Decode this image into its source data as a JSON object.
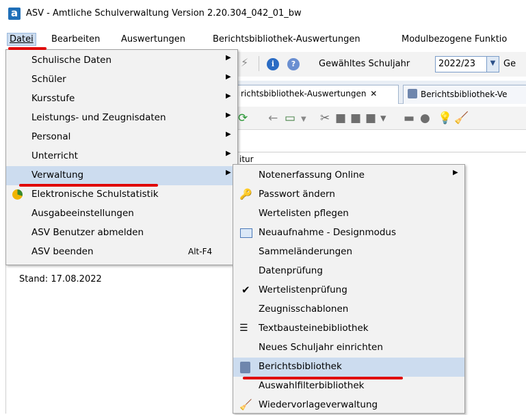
{
  "window": {
    "title": "ASV - Amtliche Schulverwaltung Version 2.20.304_042_01_bw",
    "logo_letter": "a"
  },
  "menubar": [
    {
      "label": "Datei"
    },
    {
      "label": "Bearbeiten"
    },
    {
      "label": "Auswertungen"
    },
    {
      "label": "Berichtsbibliothek-Auswertungen"
    },
    {
      "label": "Modulbezogene Funktio"
    }
  ],
  "toolbar": {
    "schuljahr_label": "Gewähltes Schuljahr",
    "schuljahr_value": "2022/23",
    "trailing_text": "Ge"
  },
  "tabs": [
    {
      "label": "richtsbibliothek-Auswertungen",
      "close": "✕"
    },
    {
      "label": "Berichtsbibliothek-Ve"
    }
  ],
  "partial_label": "itur",
  "stand": "Stand: 17.08.2022",
  "datei_menu": [
    {
      "label": "Schulische Daten",
      "submenu": true
    },
    {
      "label": "Schüler",
      "submenu": true
    },
    {
      "label": "Kursstufe",
      "submenu": true
    },
    {
      "label": "Leistungs- und Zeugnisdaten",
      "submenu": true
    },
    {
      "label": "Personal",
      "submenu": true
    },
    {
      "label": "Unterricht",
      "submenu": true
    },
    {
      "label": "Verwaltung",
      "submenu": true,
      "highlighted": true
    },
    {
      "label": "Elektronische Schulstatistik",
      "icon": "pie-chart-icon"
    },
    {
      "label": "Ausgabeeinstellungen"
    },
    {
      "label": "ASV Benutzer abmelden"
    },
    {
      "label": "ASV beenden",
      "shortcut": "Alt-F4"
    }
  ],
  "verwaltung_menu": [
    {
      "label": "Notenerfassung Online",
      "submenu": true
    },
    {
      "label": "Passwort ändern",
      "icon": "key-icon"
    },
    {
      "label": "Wertelisten pflegen"
    },
    {
      "label": "Neuaufnahme - Designmodus",
      "icon": "form-icon"
    },
    {
      "label": "Sammeländerungen"
    },
    {
      "label": "Datenprüfung"
    },
    {
      "label": "Wertelistenprüfung",
      "icon": "check-icon"
    },
    {
      "label": "Zeugnisschablonen"
    },
    {
      "label": "Textbausteinebibliothek",
      "icon": "text-icon"
    },
    {
      "label": "Neues Schuljahr einrichten"
    },
    {
      "label": "Berichtsbibliothek",
      "icon": "report-icon",
      "highlighted": true
    },
    {
      "label": "Auswahlfilterbibliothek"
    },
    {
      "label": "Wiedervorlageverwaltung",
      "icon": "broom-icon"
    }
  ],
  "colors": {
    "highlight": "#ccdcef",
    "annotation": "#e00000",
    "menu_bg": "#f2f2f2"
  }
}
